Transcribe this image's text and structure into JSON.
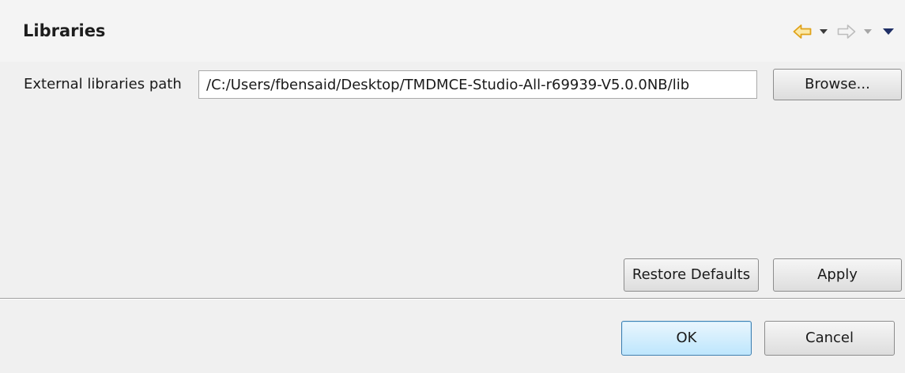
{
  "page": {
    "title": "Libraries"
  },
  "header_nav": {
    "back_icon": "back-arrow-icon",
    "back_color": "#e0a219",
    "back_menu_icon": "chevron-down-icon",
    "forward_icon": "forward-arrow-icon",
    "forward_state": "disabled",
    "forward_menu_icon": "chevron-down-icon",
    "view_menu_icon": "view-menu-icon",
    "view_menu_color": "#1f2f66"
  },
  "form": {
    "path_label": "External libraries path",
    "path_value": "/C:/Users/fbensaid/Desktop/TMDMCE-Studio-All-r69939-V5.0.0NB/lib",
    "browse_label": "Browse..."
  },
  "page_buttons": {
    "restore_label": "Restore Defaults",
    "apply_label": "Apply"
  },
  "dialog_buttons": {
    "ok_label": "OK",
    "cancel_label": "Cancel",
    "ok_accent": "#3c7fb1"
  }
}
